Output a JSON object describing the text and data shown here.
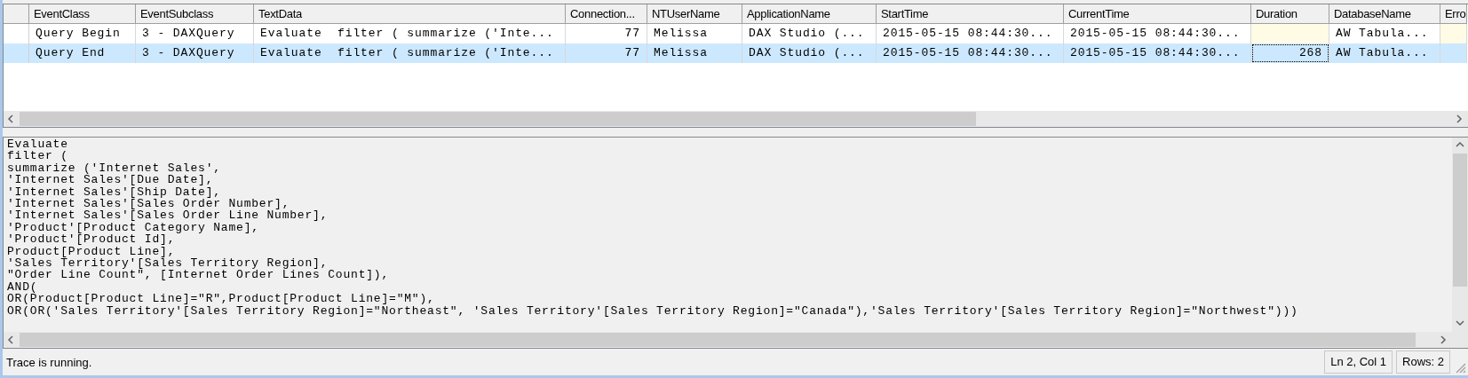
{
  "grid": {
    "columns": [
      {
        "label": "EventClass",
        "kind": "text"
      },
      {
        "label": "EventSubclass",
        "kind": "text"
      },
      {
        "label": "TextData",
        "kind": "text"
      },
      {
        "label": "Connection...",
        "kind": "number"
      },
      {
        "label": "NTUserName",
        "kind": "text"
      },
      {
        "label": "ApplicationName",
        "kind": "text"
      },
      {
        "label": "StartTime",
        "kind": "text"
      },
      {
        "label": "CurrentTime",
        "kind": "text"
      },
      {
        "label": "Duration",
        "kind": "number"
      },
      {
        "label": "DatabaseName",
        "kind": "text"
      },
      {
        "label": "Erro",
        "kind": "text"
      }
    ],
    "rows": [
      {
        "selected": false,
        "cells": [
          {
            "text": "Query Begin"
          },
          {
            "text": "3 - DAXQuery"
          },
          {
            "text": "Evaluate  filter ( summarize ('Inte..."
          },
          {
            "text": "77"
          },
          {
            "text": "Melissa"
          },
          {
            "text": "DAX Studio (..."
          },
          {
            "text": "2015-05-15 08:44:30..."
          },
          {
            "text": "2015-05-15 08:44:30..."
          },
          {
            "highlight": true
          },
          {
            "text": "AW Tabula..."
          },
          {
            "highlight": true
          }
        ]
      },
      {
        "selected": true,
        "cells": [
          {
            "text": "Query End"
          },
          {
            "text": "3 - DAXQuery"
          },
          {
            "text": "Evaluate  filter ( summarize ('Inte..."
          },
          {
            "text": "77"
          },
          {
            "text": "Melissa"
          },
          {
            "text": "DAX Studio (..."
          },
          {
            "text": "2015-05-15 08:44:30..."
          },
          {
            "text": "2015-05-15 08:44:30..."
          },
          {
            "text": "268",
            "focused": true
          },
          {
            "text": "AW Tabula..."
          },
          {}
        ]
      }
    ]
  },
  "query_text": [
    "Evaluate",
    "filter (",
    "summarize ('Internet Sales',",
    "'Internet Sales'[Due Date],",
    "'Internet Sales'[Ship Date],",
    "'Internet Sales'[Sales Order Number],",
    "'Internet Sales'[Sales Order Line Number],",
    "'Product'[Product Category Name],",
    "'Product'[Product Id],",
    "Product[Product Line],",
    "'Sales Territory'[Sales Territory Region],",
    "\"Order Line Count\", [Internet Order Lines Count]),",
    "AND(",
    "OR(Product[Product Line]=\"R\",Product[Product Line]=\"M\"),",
    "OR(OR('Sales Territory'[Sales Territory Region]=\"Northeast\", 'Sales Territory'[Sales Territory Region]=\"Canada\"),'Sales Territory'[Sales Territory Region]=\"Northwest\")))"
  ],
  "status_bar": {
    "message": "Trace is running.",
    "position": "Ln 2, Col 1",
    "rows": "Rows: 2"
  }
}
